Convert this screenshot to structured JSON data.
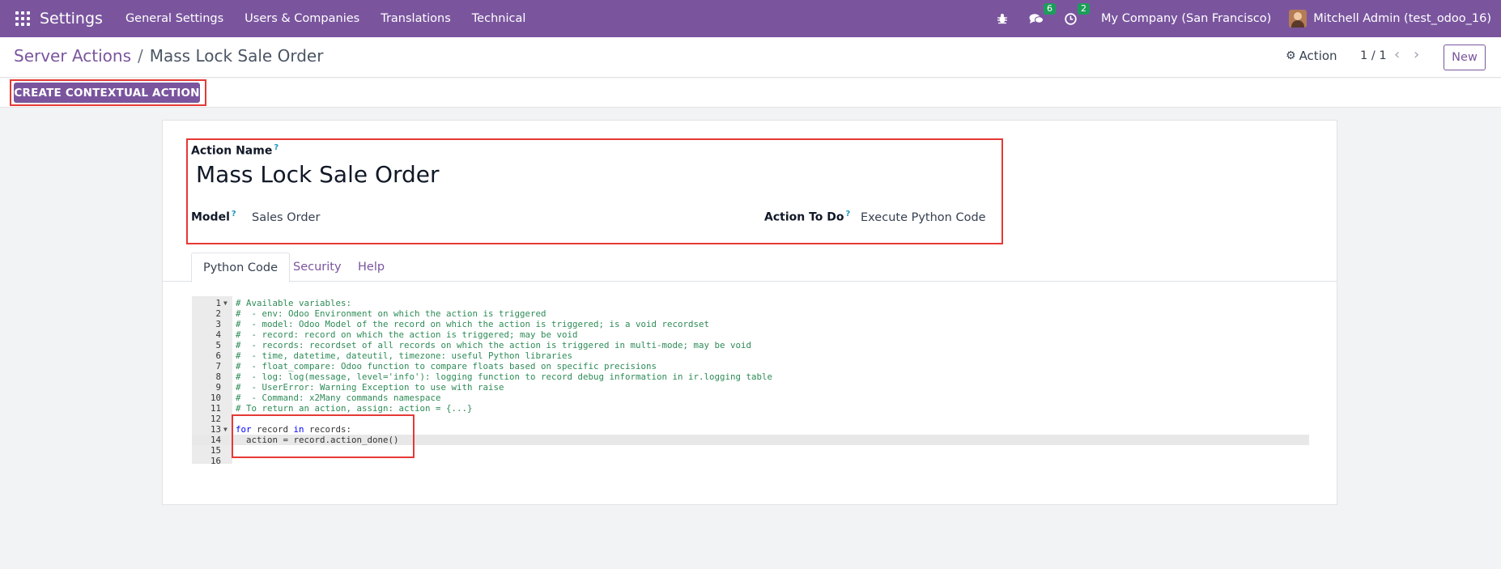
{
  "navbar": {
    "brand": "Settings",
    "menu": [
      "General Settings",
      "Users & Companies",
      "Translations",
      "Technical"
    ],
    "messages_count": "6",
    "activities_count": "2",
    "company": "My Company (San Francisco)",
    "user": "Mitchell Admin (test_odoo_16)",
    "accent_color": "#7a559e"
  },
  "control_panel": {
    "breadcrumb_parent": "Server Actions",
    "breadcrumb_separator": "/",
    "breadcrumb_current": "Mass Lock Sale Order",
    "action_label": "Action",
    "pager": "1 / 1",
    "new_label": "New"
  },
  "statusbar": {
    "contextual_button": "CREATE CONTEXTUAL ACTION"
  },
  "form": {
    "action_name_label": "Action Name",
    "action_name_value": "Mass Lock Sale Order",
    "model_label": "Model",
    "model_value": "Sales Order",
    "action_to_do_label": "Action To Do",
    "action_to_do_value": "Execute Python Code",
    "help_mark": "?"
  },
  "tabs": [
    "Python Code",
    "Security",
    "Help"
  ],
  "code_lines": [
    {
      "n": "1",
      "text": "# Available variables:",
      "type": "comment",
      "fold": true
    },
    {
      "n": "2",
      "text": "#  - env: Odoo Environment on which the action is triggered",
      "type": "comment"
    },
    {
      "n": "3",
      "text": "#  - model: Odoo Model of the record on which the action is triggered; is a void recordset",
      "type": "comment"
    },
    {
      "n": "4",
      "text": "#  - record: record on which the action is triggered; may be void",
      "type": "comment"
    },
    {
      "n": "5",
      "text": "#  - records: recordset of all records on which the action is triggered in multi-mode; may be void",
      "type": "comment"
    },
    {
      "n": "6",
      "text": "#  - time, datetime, dateutil, timezone: useful Python libraries",
      "type": "comment"
    },
    {
      "n": "7",
      "text": "#  - float_compare: Odoo function to compare floats based on specific precisions",
      "type": "comment"
    },
    {
      "n": "8",
      "text": "#  - log: log(message, level='info'): logging function to record debug information in ir.logging table",
      "type": "comment"
    },
    {
      "n": "9",
      "text": "#  - UserError: Warning Exception to use with raise",
      "type": "comment"
    },
    {
      "n": "10",
      "text": "#  - Command: x2Many commands namespace",
      "type": "comment"
    },
    {
      "n": "11",
      "text": "# To return an action, assign: action = {...}",
      "type": "comment"
    },
    {
      "n": "12",
      "text": "",
      "type": "code"
    },
    {
      "n": "13",
      "text": "for record in records:",
      "type": "code",
      "fold": true
    },
    {
      "n": "14",
      "text": "  action = record.action_done()",
      "type": "code",
      "active": true
    },
    {
      "n": "15",
      "text": "",
      "type": "code"
    },
    {
      "n": "16",
      "text": "",
      "type": "code"
    }
  ]
}
